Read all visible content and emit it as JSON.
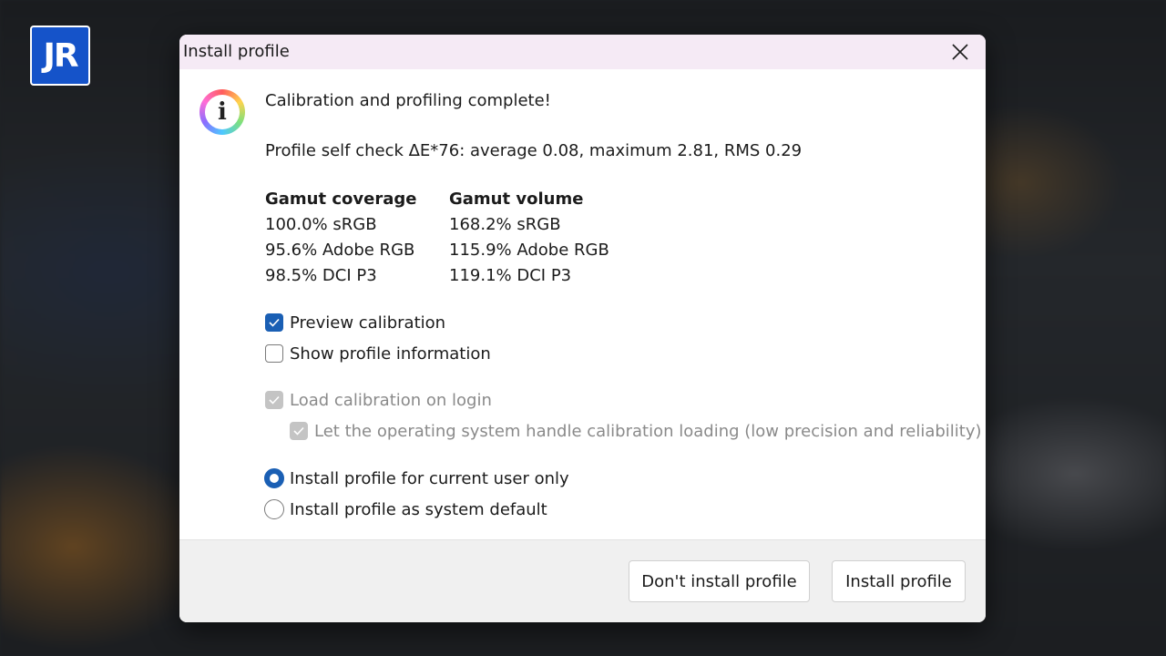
{
  "branding": {
    "logo_text": "JR"
  },
  "dialog": {
    "title": "Install profile",
    "heading": "Calibration and profiling complete!",
    "self_check": "Profile self check ΔE*76: average 0.08, maximum 2.81, RMS 0.29",
    "gamut_coverage": {
      "header": "Gamut coverage",
      "rows": [
        "100.0% sRGB",
        "95.6% Adobe RGB",
        "98.5% DCI P3"
      ]
    },
    "gamut_volume": {
      "header": "Gamut volume",
      "rows": [
        "168.2% sRGB",
        "115.9% Adobe RGB",
        "119.1% DCI P3"
      ]
    },
    "checkboxes": {
      "preview_calibration": {
        "label": "Preview calibration",
        "checked": true,
        "enabled": true
      },
      "show_profile_information": {
        "label": "Show profile information",
        "checked": false,
        "enabled": true
      },
      "load_calibration_on_login": {
        "label": "Load calibration on login",
        "checked": true,
        "enabled": false
      },
      "os_handle_calibration": {
        "label": "Let the operating system handle calibration loading (low precision and reliability)",
        "checked": true,
        "enabled": false
      }
    },
    "radios": {
      "current_user": {
        "label": "Install profile for current user only",
        "selected": true
      },
      "system_default": {
        "label": "Install profile as system default",
        "selected": false
      }
    },
    "buttons": {
      "dont_install": "Don't install profile",
      "install": "Install profile"
    }
  },
  "colors": {
    "accent": "#1a5fb4",
    "titlebar": "#f5eaf5",
    "logo_bg": "#1553c9"
  },
  "icons": {
    "close": "close-icon",
    "info": "info-icon",
    "check": "checkmark-icon"
  }
}
